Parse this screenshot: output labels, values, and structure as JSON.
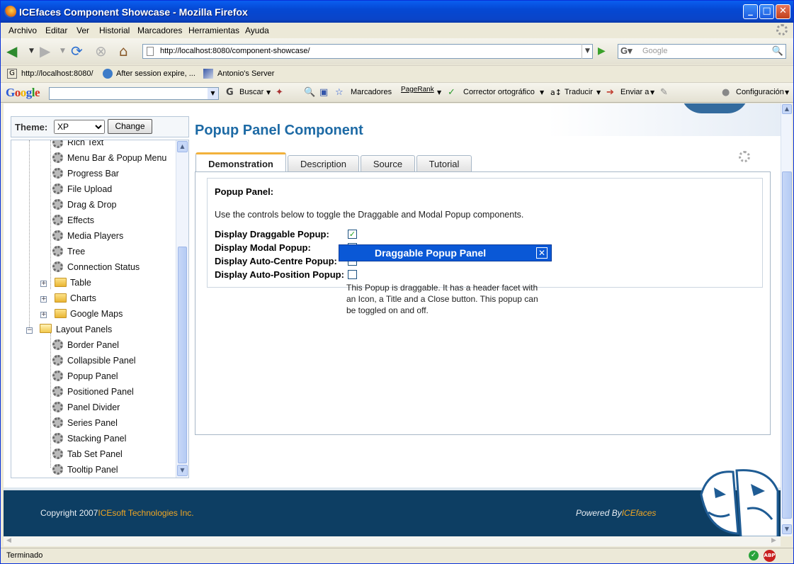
{
  "window": {
    "title": "ICEfaces Component Showcase - Mozilla Firefox"
  },
  "menu": [
    "Archivo",
    "Editar",
    "Ver",
    "Historial",
    "Marcadores",
    "Herramientas",
    "Ayuda"
  ],
  "nav": {
    "url": "http://localhost:8080/component-showcase/",
    "search_placeholder": "Google"
  },
  "bookmarks": [
    "http://localhost:8080/",
    "After session expire, ...",
    "Antonio's Server"
  ],
  "google_toolbar": {
    "logo": "Google",
    "search": "Buscar",
    "bookmarks": "Marcadores",
    "pagerank": "PageRank",
    "spellcheck": "Corrector ortográfico",
    "translate": "Traducir",
    "send": "Enviar a",
    "settings": "Configuración"
  },
  "theme": {
    "label": "Theme:",
    "selected": "XP",
    "button": "Change"
  },
  "tree": {
    "items": [
      "Rich Text",
      "Menu Bar & Popup Menu",
      "Progress Bar",
      "File Upload",
      "Drag & Drop",
      "Effects",
      "Media Players",
      "Tree",
      "Connection Status"
    ],
    "folders": [
      "Table",
      "Charts",
      "Google Maps"
    ],
    "layout_folder": "Layout Panels",
    "layout_items": [
      "Border Panel",
      "Collapsible Panel",
      "Popup Panel",
      "Positioned Panel",
      "Panel Divider",
      "Series Panel",
      "Stacking Panel",
      "Tab Set Panel",
      "Tooltip Panel"
    ]
  },
  "main": {
    "title": "Popup Panel Component",
    "tabs": [
      "Demonstration",
      "Description",
      "Source",
      "Tutorial"
    ],
    "heading": "Popup Panel:",
    "description": "Use the controls below to toggle the Draggable and Modal Popup components.",
    "options": [
      {
        "label": "Display Draggable Popup:",
        "checked": true
      },
      {
        "label": "Display Modal Popup:",
        "checked": false
      },
      {
        "label": "Display Auto-Centre Popup:",
        "checked": false
      },
      {
        "label": "Display Auto-Position Popup:",
        "checked": false
      }
    ]
  },
  "popup": {
    "title": "Draggable Popup Panel",
    "body": "This Popup is draggable. It has a header facet with an Icon, a Title and a Close button. This popup can be toggled on and off."
  },
  "footer": {
    "copyright_prefix": "Copyright 2007",
    "copyright_company": "ICEsoft Technologies Inc.",
    "powered_prefix": "Powered By",
    "powered_name": "ICEfaces"
  },
  "status": {
    "text": "Terminado"
  }
}
